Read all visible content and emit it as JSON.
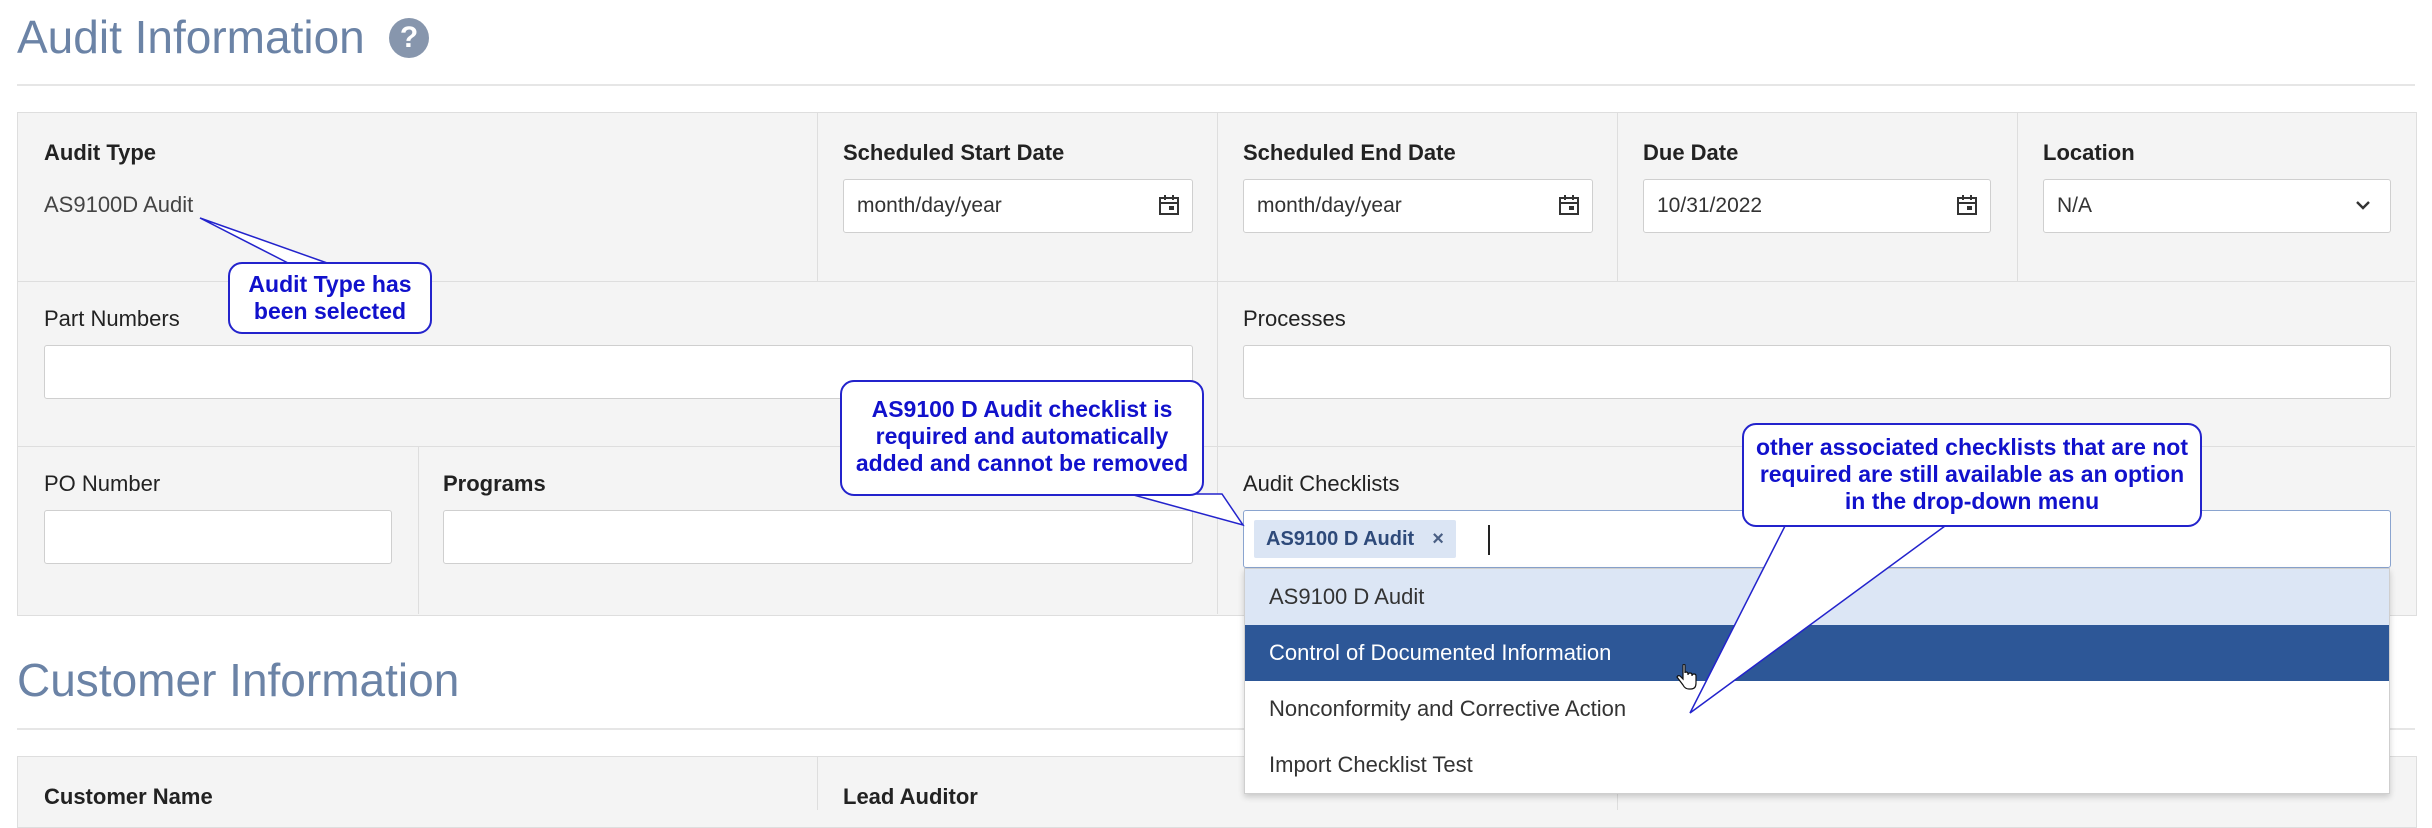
{
  "audit_section": {
    "title": "Audit Information",
    "help": "?"
  },
  "fields": {
    "audit_type": {
      "label": "Audit Type",
      "value": "AS9100D Audit"
    },
    "scheduled_start_date": {
      "label": "Scheduled Start Date",
      "placeholder": "month/day/year"
    },
    "scheduled_end_date": {
      "label": "Scheduled End Date",
      "placeholder": "month/day/year"
    },
    "due_date": {
      "label": "Due Date",
      "value": "10/31/2022"
    },
    "location": {
      "label": "Location",
      "value": "N/A"
    },
    "part_numbers": {
      "label": "Part Numbers"
    },
    "processes": {
      "label": "Processes"
    },
    "po_number": {
      "label": "PO Number"
    },
    "programs": {
      "label": "Programs"
    },
    "audit_checklists": {
      "label": "Audit Checklists",
      "selected_tag": "AS9100 D Audit",
      "remove": "×",
      "options": [
        "AS9100 D Audit",
        "Control of Documented Information",
        "Nonconformity and Corrective Action",
        "Import Checklist Test"
      ]
    }
  },
  "customer_section": {
    "title": "Customer Information"
  },
  "customer_fields": {
    "customer_name": "Customer Name",
    "lead_auditor": "Lead Auditor"
  },
  "callouts": {
    "audit_type": [
      "Audit Type has",
      "been selected"
    ],
    "required_checklist": [
      "AS9100 D Audit checklist is",
      "required and automatically",
      "added and cannot be removed"
    ],
    "other_checklists": [
      "other associated checklists that are not",
      "required are still available as an option",
      "in the drop-down menu"
    ]
  },
  "colors": {
    "heading": "#6b83a6",
    "option_hover": "#2d5797",
    "option_selected": "#dce6f5",
    "callout": "#1111cc"
  }
}
